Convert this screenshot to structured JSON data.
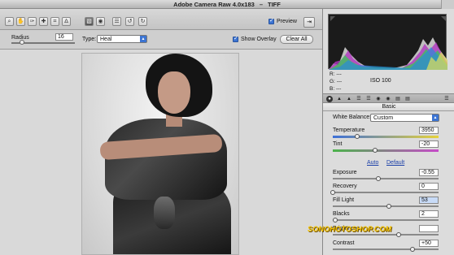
{
  "window": {
    "title": "Adobe Camera Raw 4.0x183",
    "separator": "–",
    "format": "TIFF"
  },
  "toolbar": {
    "tools": [
      {
        "name": "zoom-icon",
        "glyph": "⌕"
      },
      {
        "name": "hand-icon",
        "glyph": "✋"
      },
      {
        "name": "eyedropper-icon",
        "glyph": "✑"
      },
      {
        "name": "color-sampler-icon",
        "glyph": "✚"
      },
      {
        "name": "crop-icon",
        "glyph": "⌗"
      },
      {
        "name": "straighten-icon",
        "glyph": "∆"
      },
      {
        "name": "retouch-icon",
        "glyph": "▧"
      },
      {
        "name": "red-eye-icon",
        "glyph": "◉"
      },
      {
        "name": "preferences-icon",
        "glyph": "☰"
      },
      {
        "name": "rotate-left-icon",
        "glyph": "↺"
      },
      {
        "name": "rotate-right-icon",
        "glyph": "↻"
      }
    ],
    "active_tool": "retouch-icon",
    "preview_label": "Preview",
    "preview_checked": true,
    "fullscreen_glyph": "⇥"
  },
  "options": {
    "radius_label": "Radius",
    "radius_value": "16",
    "type_label": "Type:",
    "type_value": "Heal",
    "show_overlay_label": "Show Overlay",
    "show_overlay_checked": true,
    "clear_all_label": "Clear All"
  },
  "histogram": {
    "r_label": "R:",
    "g_label": "G:",
    "b_label": "B:",
    "r_value": "---",
    "g_value": "---",
    "b_value": "---",
    "iso": "ISO 100"
  },
  "panel": {
    "section_title": "Basic",
    "white_balance_label": "White Balance:",
    "white_balance_value": "Custom",
    "auto_label": "Auto",
    "default_label": "Default",
    "controls": [
      {
        "key": "temperature",
        "label": "Temperature",
        "value": "3950",
        "level": 0.23
      },
      {
        "key": "tint",
        "label": "Tint",
        "value": "-20",
        "level": 0.4
      },
      {
        "key": "exposure",
        "label": "Exposure",
        "value": "-0.55",
        "level": 0.43
      },
      {
        "key": "recovery",
        "label": "Recovery",
        "value": "0",
        "level": 0.0
      },
      {
        "key": "fill_light",
        "label": "Fill Light",
        "value": "53",
        "level": 0.53
      },
      {
        "key": "blacks",
        "label": "Blacks",
        "value": "2",
        "level": 0.02
      },
      {
        "key": "brightness",
        "label": "Brightness",
        "value": "",
        "level": 0.62
      },
      {
        "key": "contrast",
        "label": "Contrast",
        "value": "+50",
        "level": 0.75
      }
    ]
  },
  "watermark": "SONOHOTOSHOP.COM",
  "colors": {
    "accent": "#3c74d2",
    "watermark": "#f2c200"
  }
}
